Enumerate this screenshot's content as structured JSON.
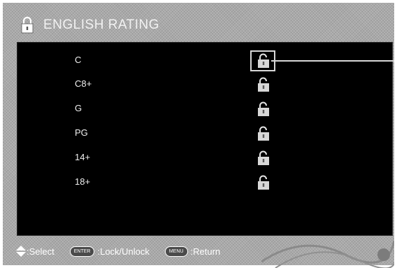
{
  "header": {
    "icon": "lock-icon",
    "title": "ENGLISH RATING"
  },
  "ratings": [
    {
      "label": "C"
    },
    {
      "label": "C8+"
    },
    {
      "label": "G"
    },
    {
      "label": "PG"
    },
    {
      "label": "14+"
    },
    {
      "label": "18+"
    }
  ],
  "footer": {
    "select_label": ":Select",
    "enter_key": "ENTER",
    "lock_label": ":Lock/Unlock",
    "menu_key": "MENU",
    "return_label": ":Return"
  }
}
